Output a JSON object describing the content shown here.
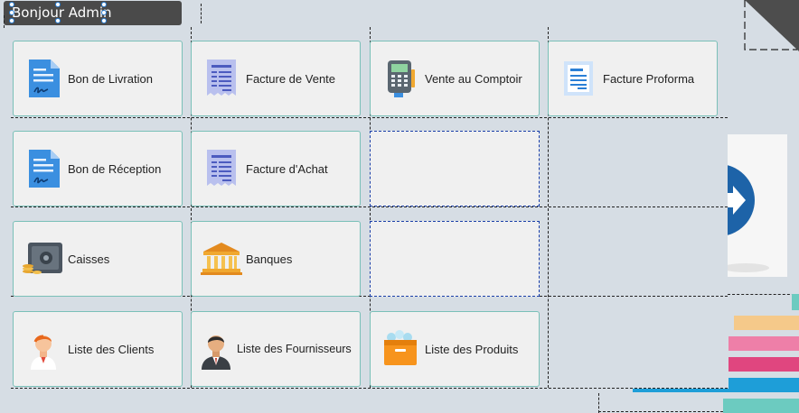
{
  "header": {
    "greeting": "Bonjour Admin"
  },
  "tiles": [
    {
      "label": "Bon de Livration",
      "icon": "delivery-note-icon"
    },
    {
      "label": "Facture de Vente",
      "icon": "sales-invoice-icon"
    },
    {
      "label": "Vente au Comptoir",
      "icon": "payment-terminal-icon"
    },
    {
      "label": "Facture Proforma",
      "icon": "proforma-invoice-icon"
    },
    {
      "label": "Bon de Réception",
      "icon": "receipt-note-icon"
    },
    {
      "label": "Facture d'Achat",
      "icon": "purchase-invoice-icon"
    },
    {
      "label": "Caisses",
      "icon": "safe-icon"
    },
    {
      "label": "Banques",
      "icon": "bank-icon"
    },
    {
      "label": "Liste des Clients",
      "icon": "client-person-icon"
    },
    {
      "label": "Liste des Fournisseurs",
      "icon": "supplier-person-icon"
    },
    {
      "label": "Liste des Produits",
      "icon": "product-box-icon"
    }
  ],
  "colors": {
    "tile_border": "#7ac0b8",
    "background": "#d6dde4",
    "stripes": [
      "#f5c98a",
      "#ee7fa8",
      "#e0467f",
      "#1e9ed8",
      "#6ccbc0"
    ]
  }
}
